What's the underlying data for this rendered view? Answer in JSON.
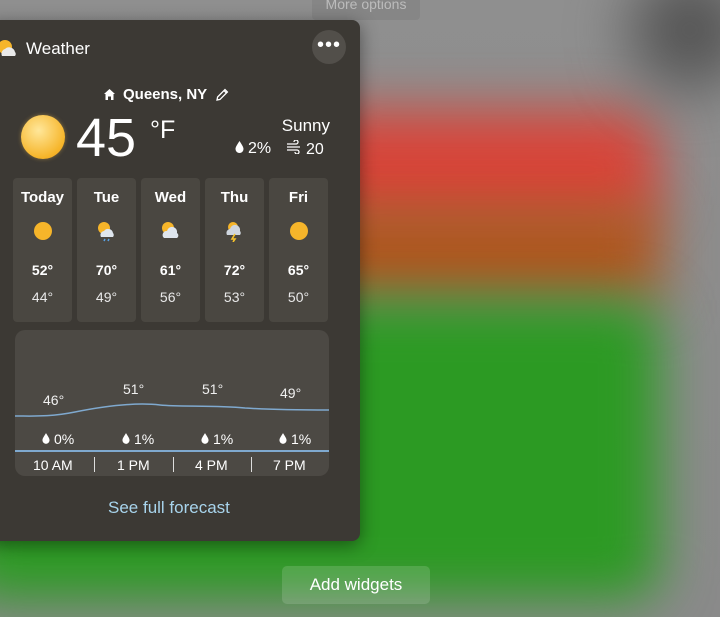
{
  "tooltip": {
    "text": "More options"
  },
  "widget": {
    "title": "Weather",
    "location": "Queens, NY",
    "current": {
      "temp": "45",
      "unit": "°F",
      "condition": "Sunny",
      "precip": "2%",
      "wind": "20"
    },
    "daily": [
      {
        "day": "Today",
        "hi": "52°",
        "lo": "44°",
        "icon": "sunny-icon"
      },
      {
        "day": "Tue",
        "hi": "70°",
        "lo": "49°",
        "icon": "partly-cloudy-rain-icon"
      },
      {
        "day": "Wed",
        "hi": "61°",
        "lo": "56°",
        "icon": "partly-cloudy-icon"
      },
      {
        "day": "Thu",
        "hi": "72°",
        "lo": "53°",
        "icon": "thunderstorm-icon"
      },
      {
        "day": "Fri",
        "hi": "65°",
        "lo": "50°",
        "icon": "sunny-icon"
      }
    ],
    "hourly": [
      {
        "time": "10 AM",
        "temp": "46°",
        "precip": "0%"
      },
      {
        "time": "1 PM",
        "temp": "51°",
        "precip": "1%"
      },
      {
        "time": "4 PM",
        "temp": "51°",
        "precip": "1%"
      },
      {
        "time": "7 PM",
        "temp": "49°",
        "precip": "1%"
      }
    ],
    "forecast_link": "See full forecast"
  },
  "add_widgets": "Add widgets",
  "colors": {
    "link": "#a8d4ec",
    "curve": "#7fa9cf",
    "sun": "#f6b52a"
  }
}
